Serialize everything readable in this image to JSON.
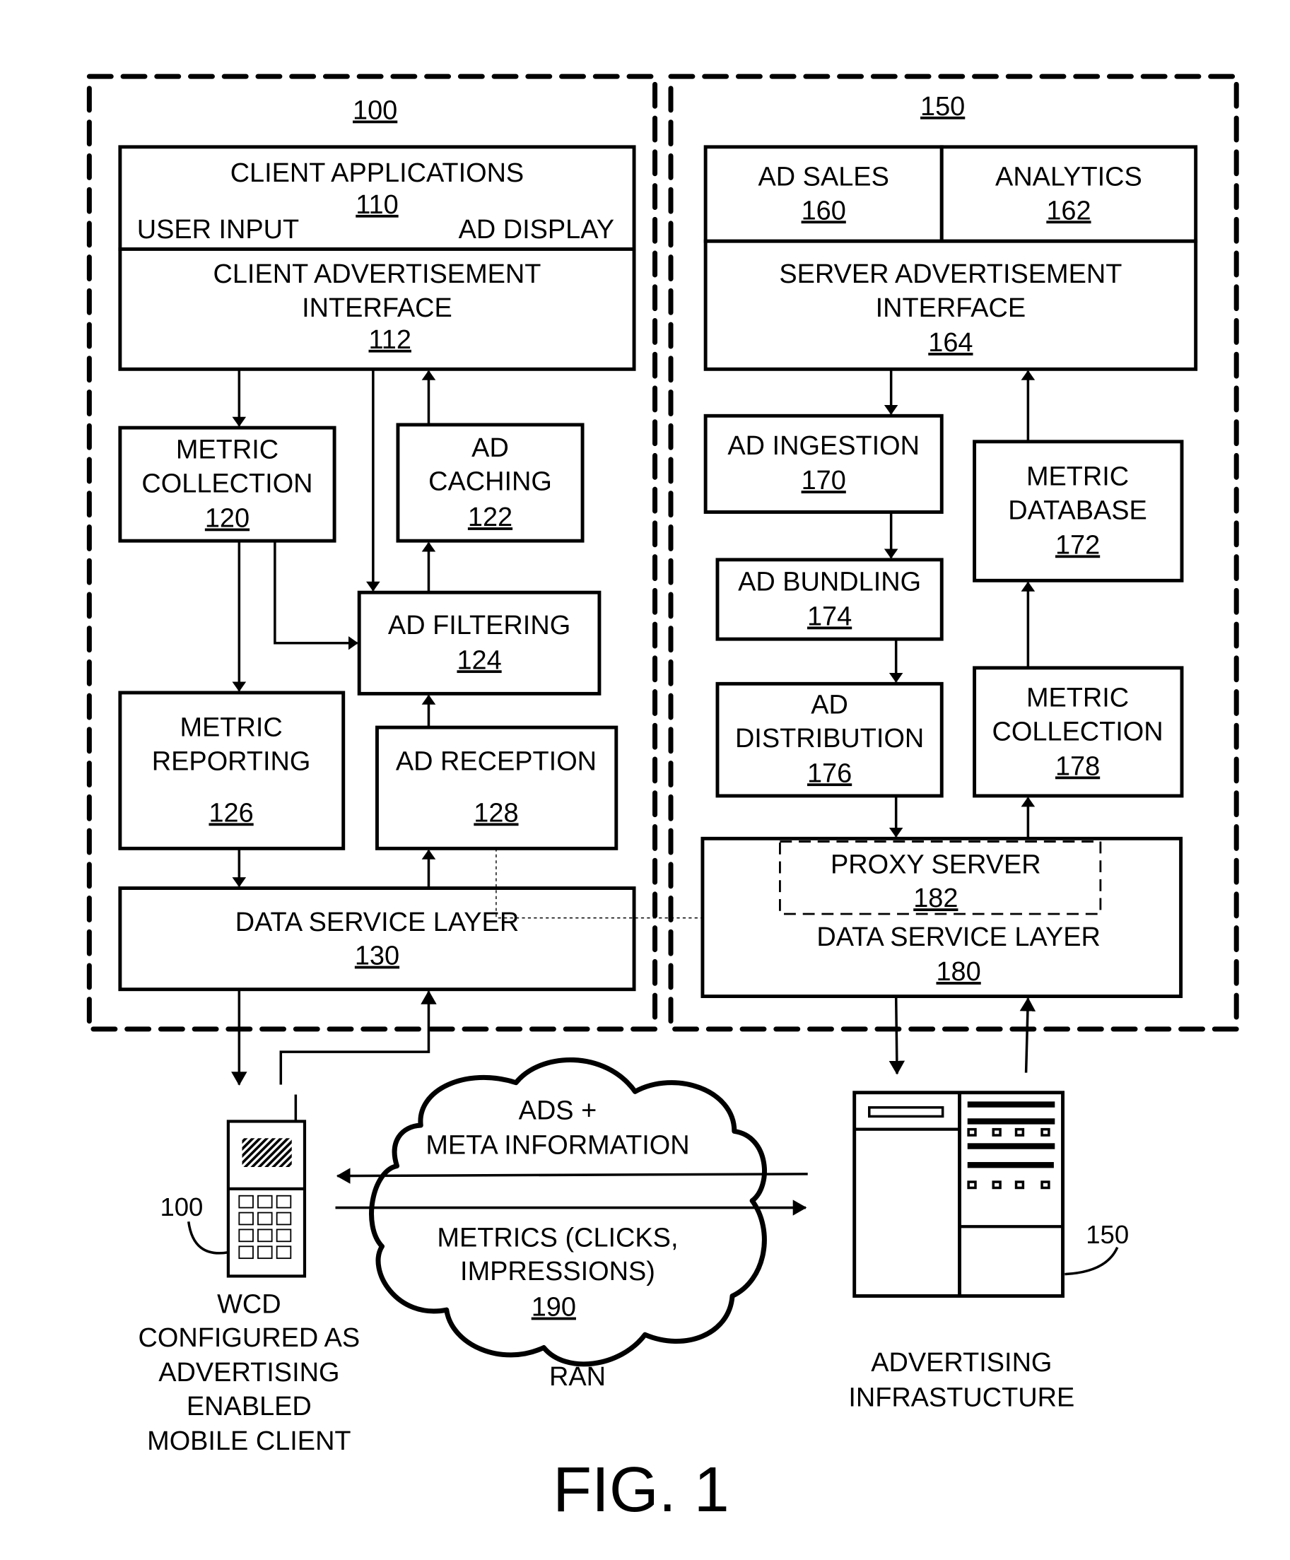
{
  "figure": {
    "label": "FIG. 1"
  },
  "client_group": {
    "ref": "100"
  },
  "server_group": {
    "ref": "150"
  },
  "blocks": {
    "client_apps": {
      "title": "CLIENT APPLICATIONS",
      "ref": "110",
      "left": "USER INPUT",
      "right": "AD DISPLAY"
    },
    "client_ad_iface": {
      "line1": "CLIENT ADVERTISEMENT",
      "line2": "INTERFACE",
      "ref": "112"
    },
    "metric_collection_c": {
      "line1": "METRIC",
      "line2": "COLLECTION",
      "ref": "120"
    },
    "ad_caching": {
      "line1": "AD",
      "line2": "CACHING",
      "ref": "122"
    },
    "ad_filtering": {
      "line1": "AD FILTERING",
      "ref": "124"
    },
    "metric_reporting": {
      "line1": "METRIC",
      "line2": "REPORTING",
      "ref": "126"
    },
    "ad_reception": {
      "line1": "AD RECEPTION",
      "ref": "128"
    },
    "data_service_c": {
      "line1": "DATA SERVICE LAYER",
      "ref": "130"
    },
    "ad_sales": {
      "line1": "AD SALES",
      "ref": "160"
    },
    "analytics": {
      "line1": "ANALYTICS",
      "ref": "162"
    },
    "server_ad_iface": {
      "line1": "SERVER ADVERTISEMENT",
      "line2": "INTERFACE",
      "ref": "164"
    },
    "ad_ingestion": {
      "line1": "AD INGESTION",
      "ref": "170"
    },
    "metric_database": {
      "line1": "METRIC",
      "line2": "DATABASE",
      "ref": "172"
    },
    "ad_bundling": {
      "line1": "AD BUNDLING",
      "ref": "174"
    },
    "ad_distribution": {
      "line1": "AD",
      "line2": "DISTRIBUTION",
      "ref": "176"
    },
    "metric_collection_s": {
      "line1": "METRIC",
      "line2": "COLLECTION",
      "ref": "178"
    },
    "proxy_server": {
      "line1": "PROXY SERVER",
      "ref": "182"
    },
    "data_service_s": {
      "line1": "DATA SERVICE LAYER",
      "ref": "180"
    }
  },
  "network": {
    "top_line1": "ADS +",
    "top_line2": "META INFORMATION",
    "bottom_line1": "METRICS (CLICKS,",
    "bottom_line2": "IMPRESSIONS)",
    "ref": "190",
    "caption": "RAN"
  },
  "device": {
    "ref": "100",
    "caption": [
      "WCD",
      "CONFIGURED AS",
      "ADVERTISING",
      "ENABLED",
      "MOBILE CLIENT"
    ]
  },
  "infrastructure": {
    "ref": "150",
    "caption": [
      "ADVERTISING",
      "INFRASTUCTURE"
    ]
  }
}
